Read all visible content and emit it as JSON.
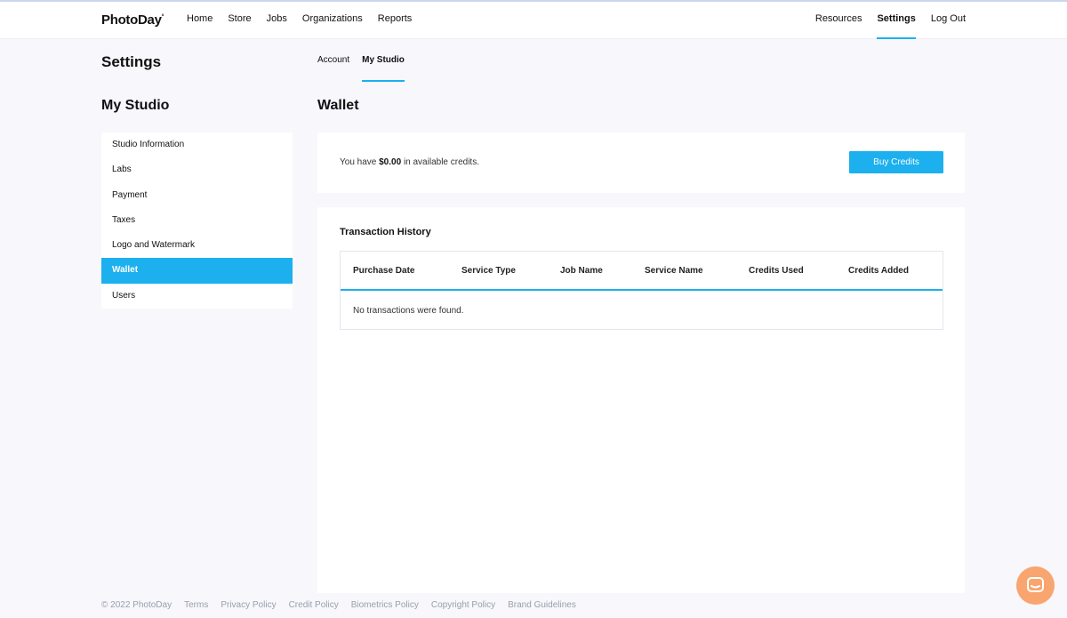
{
  "brand": {
    "logo": "PhotoDay",
    "logo_mark": "°"
  },
  "nav": {
    "left": [
      "Home",
      "Store",
      "Jobs",
      "Organizations",
      "Reports"
    ],
    "right": [
      "Resources",
      "Settings",
      "Log Out"
    ],
    "active": "Settings"
  },
  "page": {
    "title": "Settings"
  },
  "subtabs": {
    "items": [
      "Account",
      "My Studio"
    ],
    "active": "My Studio"
  },
  "sidebar": {
    "title": "My Studio",
    "items": [
      "Studio Information",
      "Labs",
      "Payment",
      "Taxes",
      "Logo and Watermark",
      "Wallet",
      "Users"
    ],
    "active": "Wallet"
  },
  "wallet": {
    "title": "Wallet",
    "credits_prefix": "You have",
    "credits_amount": "$0.00",
    "credits_suffix": "in available credits.",
    "buy_label": "Buy Credits"
  },
  "history": {
    "title": "Transaction History",
    "columns": [
      "Purchase Date",
      "Service Type",
      "Job Name",
      "Service Name",
      "Credits Used",
      "Credits Added"
    ],
    "empty_message": "No transactions were found."
  },
  "footer": {
    "items": [
      "© 2022 PhotoDay",
      "Terms",
      "Privacy Policy",
      "Credit Policy",
      "Biometrics Policy",
      "Copyright Policy",
      "Brand Guidelines"
    ]
  },
  "colors": {
    "accent": "#1cb0ee",
    "chat": "#f9a56f",
    "background": "#f7f7fc"
  },
  "icons": {
    "chat": "chat-bubble-icon"
  }
}
